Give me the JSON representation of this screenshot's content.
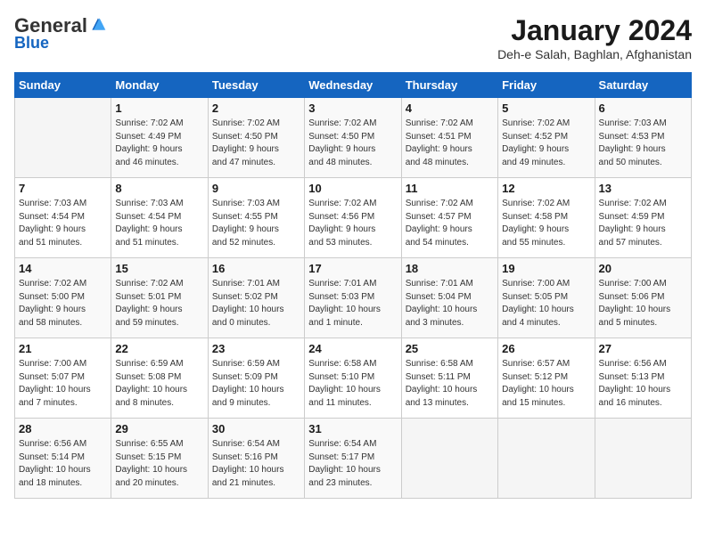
{
  "logo": {
    "general": "General",
    "blue": "Blue"
  },
  "header": {
    "title": "January 2024",
    "subtitle": "Deh-e Salah, Baghlan, Afghanistan"
  },
  "weekdays": [
    "Sunday",
    "Monday",
    "Tuesday",
    "Wednesday",
    "Thursday",
    "Friday",
    "Saturday"
  ],
  "weeks": [
    [
      {
        "day": "",
        "info": ""
      },
      {
        "day": "1",
        "info": "Sunrise: 7:02 AM\nSunset: 4:49 PM\nDaylight: 9 hours\nand 46 minutes."
      },
      {
        "day": "2",
        "info": "Sunrise: 7:02 AM\nSunset: 4:50 PM\nDaylight: 9 hours\nand 47 minutes."
      },
      {
        "day": "3",
        "info": "Sunrise: 7:02 AM\nSunset: 4:50 PM\nDaylight: 9 hours\nand 48 minutes."
      },
      {
        "day": "4",
        "info": "Sunrise: 7:02 AM\nSunset: 4:51 PM\nDaylight: 9 hours\nand 48 minutes."
      },
      {
        "day": "5",
        "info": "Sunrise: 7:02 AM\nSunset: 4:52 PM\nDaylight: 9 hours\nand 49 minutes."
      },
      {
        "day": "6",
        "info": "Sunrise: 7:03 AM\nSunset: 4:53 PM\nDaylight: 9 hours\nand 50 minutes."
      }
    ],
    [
      {
        "day": "7",
        "info": "Sunrise: 7:03 AM\nSunset: 4:54 PM\nDaylight: 9 hours\nand 51 minutes."
      },
      {
        "day": "8",
        "info": "Sunrise: 7:03 AM\nSunset: 4:54 PM\nDaylight: 9 hours\nand 51 minutes."
      },
      {
        "day": "9",
        "info": "Sunrise: 7:03 AM\nSunset: 4:55 PM\nDaylight: 9 hours\nand 52 minutes."
      },
      {
        "day": "10",
        "info": "Sunrise: 7:02 AM\nSunset: 4:56 PM\nDaylight: 9 hours\nand 53 minutes."
      },
      {
        "day": "11",
        "info": "Sunrise: 7:02 AM\nSunset: 4:57 PM\nDaylight: 9 hours\nand 54 minutes."
      },
      {
        "day": "12",
        "info": "Sunrise: 7:02 AM\nSunset: 4:58 PM\nDaylight: 9 hours\nand 55 minutes."
      },
      {
        "day": "13",
        "info": "Sunrise: 7:02 AM\nSunset: 4:59 PM\nDaylight: 9 hours\nand 57 minutes."
      }
    ],
    [
      {
        "day": "14",
        "info": "Sunrise: 7:02 AM\nSunset: 5:00 PM\nDaylight: 9 hours\nand 58 minutes."
      },
      {
        "day": "15",
        "info": "Sunrise: 7:02 AM\nSunset: 5:01 PM\nDaylight: 9 hours\nand 59 minutes."
      },
      {
        "day": "16",
        "info": "Sunrise: 7:01 AM\nSunset: 5:02 PM\nDaylight: 10 hours\nand 0 minutes."
      },
      {
        "day": "17",
        "info": "Sunrise: 7:01 AM\nSunset: 5:03 PM\nDaylight: 10 hours\nand 1 minute."
      },
      {
        "day": "18",
        "info": "Sunrise: 7:01 AM\nSunset: 5:04 PM\nDaylight: 10 hours\nand 3 minutes."
      },
      {
        "day": "19",
        "info": "Sunrise: 7:00 AM\nSunset: 5:05 PM\nDaylight: 10 hours\nand 4 minutes."
      },
      {
        "day": "20",
        "info": "Sunrise: 7:00 AM\nSunset: 5:06 PM\nDaylight: 10 hours\nand 5 minutes."
      }
    ],
    [
      {
        "day": "21",
        "info": "Sunrise: 7:00 AM\nSunset: 5:07 PM\nDaylight: 10 hours\nand 7 minutes."
      },
      {
        "day": "22",
        "info": "Sunrise: 6:59 AM\nSunset: 5:08 PM\nDaylight: 10 hours\nand 8 minutes."
      },
      {
        "day": "23",
        "info": "Sunrise: 6:59 AM\nSunset: 5:09 PM\nDaylight: 10 hours\nand 9 minutes."
      },
      {
        "day": "24",
        "info": "Sunrise: 6:58 AM\nSunset: 5:10 PM\nDaylight: 10 hours\nand 11 minutes."
      },
      {
        "day": "25",
        "info": "Sunrise: 6:58 AM\nSunset: 5:11 PM\nDaylight: 10 hours\nand 13 minutes."
      },
      {
        "day": "26",
        "info": "Sunrise: 6:57 AM\nSunset: 5:12 PM\nDaylight: 10 hours\nand 15 minutes."
      },
      {
        "day": "27",
        "info": "Sunrise: 6:56 AM\nSunset: 5:13 PM\nDaylight: 10 hours\nand 16 minutes."
      }
    ],
    [
      {
        "day": "28",
        "info": "Sunrise: 6:56 AM\nSunset: 5:14 PM\nDaylight: 10 hours\nand 18 minutes."
      },
      {
        "day": "29",
        "info": "Sunrise: 6:55 AM\nSunset: 5:15 PM\nDaylight: 10 hours\nand 20 minutes."
      },
      {
        "day": "30",
        "info": "Sunrise: 6:54 AM\nSunset: 5:16 PM\nDaylight: 10 hours\nand 21 minutes."
      },
      {
        "day": "31",
        "info": "Sunrise: 6:54 AM\nSunset: 5:17 PM\nDaylight: 10 hours\nand 23 minutes."
      },
      {
        "day": "",
        "info": ""
      },
      {
        "day": "",
        "info": ""
      },
      {
        "day": "",
        "info": ""
      }
    ]
  ]
}
